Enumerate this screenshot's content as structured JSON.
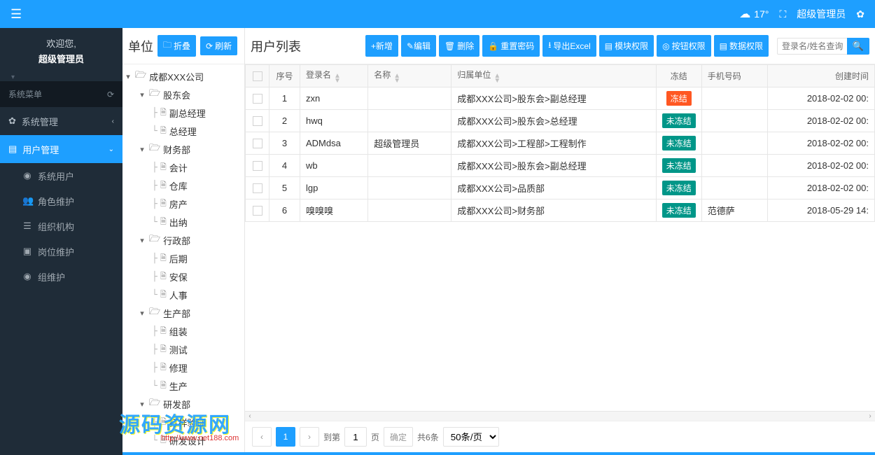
{
  "topbar": {
    "temperature": "17°",
    "user": "超级管理员"
  },
  "sidebar": {
    "welcome_title": "欢迎您,",
    "welcome_sub": "超级管理员",
    "menu_header": "系统菜单",
    "sys_mgmt": "系统管理",
    "user_mgmt": "用户管理",
    "submenu": {
      "sys_user": "系统用户",
      "role_maint": "角色维护",
      "org_struct": "组织机构",
      "post_maint": "岗位维护",
      "group_maint": "组维护"
    }
  },
  "tree": {
    "title": "单位",
    "btn_fold": "折叠",
    "btn_refresh": "刷新",
    "root": "成都XXX公司",
    "nodes": [
      {
        "label": "股东会",
        "type": "folder",
        "children": [
          {
            "label": "副总经理",
            "type": "file"
          },
          {
            "label": "总经理",
            "type": "file"
          }
        ]
      },
      {
        "label": "财务部",
        "type": "folder",
        "children": [
          {
            "label": "会计",
            "type": "file"
          },
          {
            "label": "仓库",
            "type": "file"
          },
          {
            "label": "房产",
            "type": "file"
          },
          {
            "label": "出纳",
            "type": "file"
          }
        ]
      },
      {
        "label": "行政部",
        "type": "folder",
        "children": [
          {
            "label": "后期",
            "type": "file"
          },
          {
            "label": "安保",
            "type": "file"
          },
          {
            "label": "人事",
            "type": "file"
          }
        ]
      },
      {
        "label": "生产部",
        "type": "folder",
        "children": [
          {
            "label": "组装",
            "type": "file"
          },
          {
            "label": "测试",
            "type": "file"
          },
          {
            "label": "修理",
            "type": "file"
          },
          {
            "label": "生产",
            "type": "file"
          }
        ]
      },
      {
        "label": "研发部",
        "type": "folder",
        "children": [
          {
            "label": "打样验证",
            "type": "file"
          },
          {
            "label": "研发设计",
            "type": "file"
          }
        ]
      }
    ]
  },
  "main": {
    "title": "用户列表",
    "actions": {
      "add": "+新增",
      "edit": "✎编辑",
      "del": "删除",
      "reset_pw": "重置密码",
      "export": "导出Excel",
      "mod_perm": "模块权限",
      "btn_perm": "按钮权限",
      "data_perm": "数据权限"
    },
    "search_ph": "登录名/姓名查询...",
    "cols": {
      "idx": "序号",
      "login": "登录名",
      "name": "名称",
      "dept": "归属单位",
      "freeze": "冻结",
      "phone": "手机号码",
      "ctime": "创建时间"
    },
    "freeze_red": "冻结",
    "freeze_green": "未冻结",
    "rows": [
      {
        "idx": 1,
        "login": "zxn",
        "name": "",
        "dept": "成都XXX公司>股东会>副总经理",
        "frozen": true,
        "phone": "",
        "ctime": "2018-02-02 00:"
      },
      {
        "idx": 2,
        "login": "hwq",
        "name": "",
        "dept": "成都XXX公司>股东会>总经理",
        "frozen": false,
        "phone": "",
        "ctime": "2018-02-02 00:"
      },
      {
        "idx": 3,
        "login": "ADMdsa",
        "name": "超级管理员",
        "dept": "成都XXX公司>工程部>工程制作",
        "frozen": false,
        "phone": "",
        "ctime": "2018-02-02 00:"
      },
      {
        "idx": 4,
        "login": "wb",
        "name": "",
        "dept": "成都XXX公司>股东会>副总经理",
        "frozen": false,
        "phone": "",
        "ctime": "2018-02-02 00:"
      },
      {
        "idx": 5,
        "login": "lgp",
        "name": "",
        "dept": "成都XXX公司>品质部",
        "frozen": false,
        "phone": "",
        "ctime": "2018-02-02 00:"
      },
      {
        "idx": 6,
        "login": "嗅嗅嗅",
        "name": "",
        "dept": "成都XXX公司>财务部",
        "frozen": false,
        "phone": "范德萨",
        "ctime": "2018-05-29 14:"
      }
    ]
  },
  "pager": {
    "to_page_pre": "到第",
    "to_page_suf": "页",
    "go": "确定",
    "total": "共6条",
    "per_page": "50条/页",
    "current": "1"
  },
  "watermark": {
    "text": "源码资源网",
    "url": "http://www.net188.com"
  }
}
